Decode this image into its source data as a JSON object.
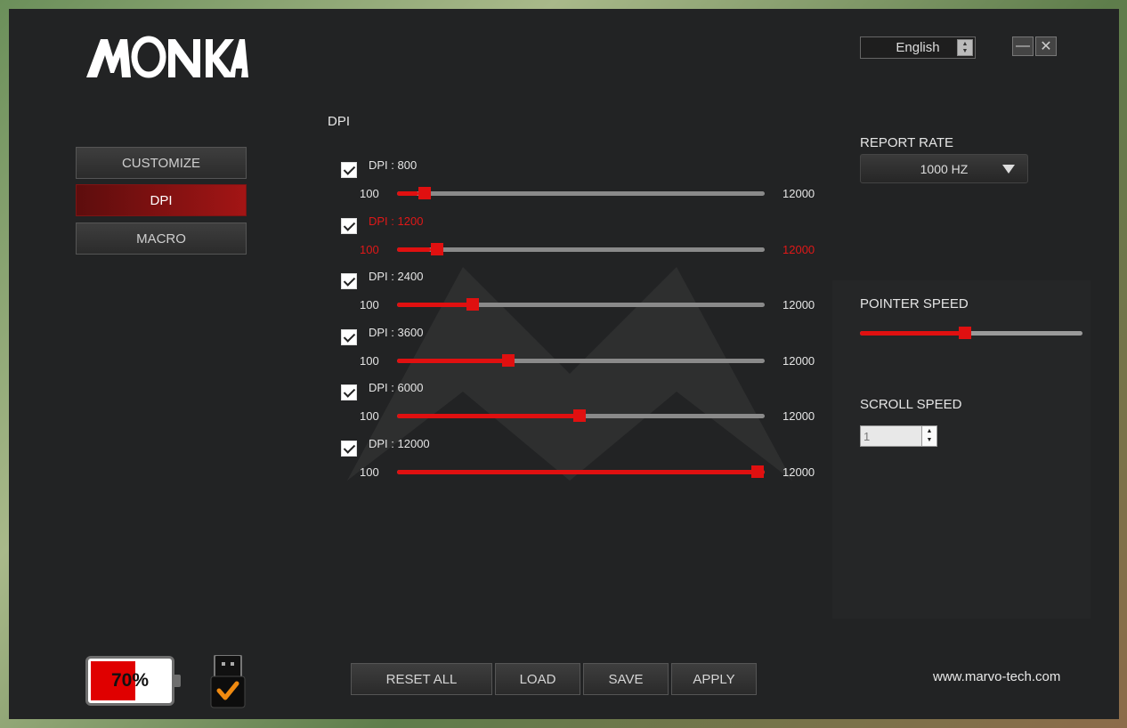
{
  "app": {
    "brand": "MONKA",
    "language": "English",
    "website": "www.marvo-tech.com"
  },
  "window_controls": {
    "minimize_icon": "minimize-icon",
    "close_icon": "close-icon"
  },
  "nav": {
    "items": [
      {
        "label": "CUSTOMIZE",
        "active": false
      },
      {
        "label": "DPI",
        "active": true
      },
      {
        "label": "MACRO",
        "active": false
      }
    ]
  },
  "dpi": {
    "title": "DPI",
    "min_label": "100",
    "max_label": "12000",
    "min": 100,
    "max": 12000,
    "levels": [
      {
        "label": "DPI : 800",
        "value": 800,
        "checked": true,
        "selected": false
      },
      {
        "label": "DPI : 1200",
        "value": 1200,
        "checked": true,
        "selected": true
      },
      {
        "label": "DPI : 2400",
        "value": 2400,
        "checked": true,
        "selected": false
      },
      {
        "label": "DPI : 3600",
        "value": 3600,
        "checked": true,
        "selected": false
      },
      {
        "label": "DPI : 6000",
        "value": 6000,
        "checked": true,
        "selected": false
      },
      {
        "label": "DPI : 12000",
        "value": 12000,
        "checked": true,
        "selected": false
      }
    ]
  },
  "report_rate": {
    "title": "REPORT RATE",
    "value": "1000 HZ"
  },
  "pointer_speed": {
    "title": "POINTER SPEED",
    "fraction": 0.47
  },
  "scroll_speed": {
    "title": "SCROLL SPEED",
    "value": "1"
  },
  "battery": {
    "label": "70%",
    "level": 0.6
  },
  "actions": {
    "reset_all": "RESET ALL",
    "load": "LOAD",
    "save": "SAVE",
    "apply": "APPLY"
  },
  "colors": {
    "accent": "#e01010",
    "background": "#222324"
  }
}
